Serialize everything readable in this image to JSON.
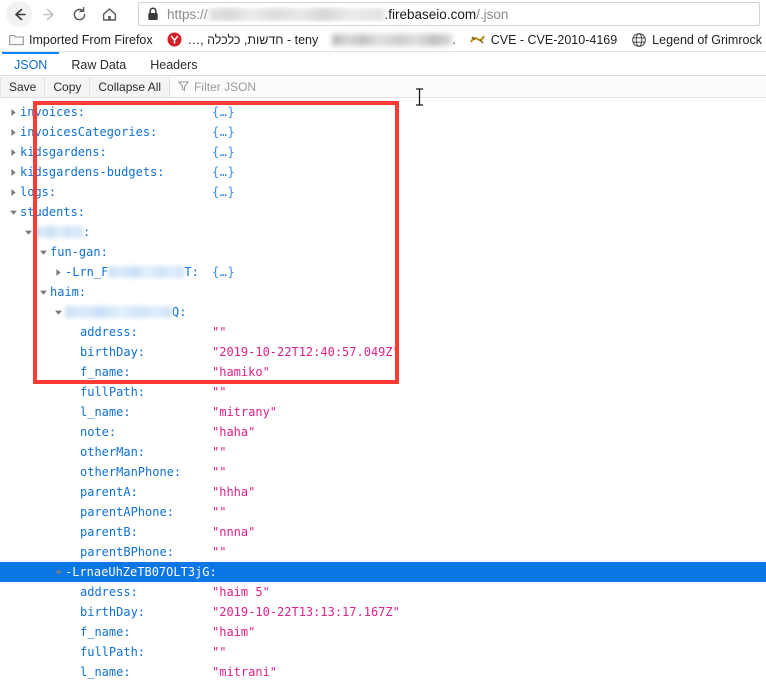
{
  "browser": {
    "nav": {
      "back_icon": "back-arrow-icon",
      "forward_icon": "forward-arrow-icon",
      "reload_icon": "reload-icon",
      "home_icon": "home-icon"
    },
    "address_bar": {
      "lock_icon": "padlock-icon",
      "scheme": "https://",
      "host_redacted": "",
      "domain": ".firebaseio.com",
      "path": "/.json"
    },
    "bookmarks": [
      {
        "icon": "folder-icon",
        "label": "Imported From Firefox",
        "redacted": false
      },
      {
        "icon": "ynet-icon",
        "label": "ynet - חדשות, כלכלה ,…",
        "redacted": false
      },
      {
        "icon": "blank-icon",
        "label": ".",
        "redacted": true
      },
      {
        "icon": "cve-icon",
        "label": "CVE - CVE-2010-4169",
        "redacted": false
      },
      {
        "icon": "globe-icon",
        "label": "Legend of Grimrock @.",
        "redacted": false
      }
    ]
  },
  "devtools": {
    "tabs": [
      {
        "label": "JSON",
        "active": true
      },
      {
        "label": "Raw Data",
        "active": false
      },
      {
        "label": "Headers",
        "active": false
      }
    ],
    "toolbar": {
      "save_label": "Save",
      "copy_label": "Copy",
      "collapse_all_label": "Collapse All",
      "filter_icon": "filter-icon",
      "filter_placeholder": "Filter JSON"
    },
    "accent_color": "#0a84ff",
    "key_color": "#0f71d3",
    "string_color": "#e0218a",
    "selection_color": "#0b76e8",
    "annotation_color": "#fb3b34"
  },
  "json_rows": [
    {
      "indent": 0,
      "twisty": "right",
      "key": "invoices",
      "value": "{…}",
      "vtype": "object"
    },
    {
      "indent": 0,
      "twisty": "right",
      "key": "invoicesCategories",
      "value": "{…}",
      "vtype": "object"
    },
    {
      "indent": 0,
      "twisty": "right",
      "key": "kidsgardens",
      "value": "{…}",
      "vtype": "object"
    },
    {
      "indent": 0,
      "twisty": "right",
      "key": "kidsgardens-budgets",
      "value": "{…}",
      "vtype": "object"
    },
    {
      "indent": 0,
      "twisty": "right",
      "key": "logs",
      "value": "{…}",
      "vtype": "object"
    },
    {
      "indent": 0,
      "twisty": "down",
      "key": "students",
      "value": "",
      "vtype": "none"
    },
    {
      "indent": 1,
      "twisty": "down",
      "key": "",
      "value": "",
      "vtype": "none",
      "redacted": true,
      "redact_width": 48
    },
    {
      "indent": 2,
      "twisty": "down",
      "key": "fun-gan",
      "value": "",
      "vtype": "none"
    },
    {
      "indent": 3,
      "twisty": "right",
      "key": "-Lrn_F",
      "key_suffix": "T",
      "value": "{…}",
      "vtype": "object",
      "redacted": true,
      "redact_width": 76
    },
    {
      "indent": 2,
      "twisty": "down",
      "key": "haim",
      "value": "",
      "vtype": "none"
    },
    {
      "indent": 3,
      "twisty": "down",
      "key": "",
      "key_suffix": "Q",
      "value": "",
      "vtype": "none",
      "redacted": true,
      "redact_width": 107
    },
    {
      "indent": 4,
      "twisty": "none",
      "key": "address",
      "value": "\"\"",
      "vtype": "string"
    },
    {
      "indent": 4,
      "twisty": "none",
      "key": "birthDay",
      "value": "\"2019-10-22T12:40:57.049Z\"",
      "vtype": "string"
    },
    {
      "indent": 4,
      "twisty": "none",
      "key": "f_name",
      "value": "\"hamiko\"",
      "vtype": "string"
    },
    {
      "indent": 4,
      "twisty": "none",
      "key": "fullPath",
      "value": "\"\"",
      "vtype": "string"
    },
    {
      "indent": 4,
      "twisty": "none",
      "key": "l_name",
      "value": "\"mitrany\"",
      "vtype": "string"
    },
    {
      "indent": 4,
      "twisty": "none",
      "key": "note",
      "value": "\"haha\"",
      "vtype": "string"
    },
    {
      "indent": 4,
      "twisty": "none",
      "key": "otherMan",
      "value": "\"\"",
      "vtype": "string"
    },
    {
      "indent": 4,
      "twisty": "none",
      "key": "otherManPhone",
      "value": "\"\"",
      "vtype": "string"
    },
    {
      "indent": 4,
      "twisty": "none",
      "key": "parentA",
      "value": "\"hhha\"",
      "vtype": "string"
    },
    {
      "indent": 4,
      "twisty": "none",
      "key": "parentAPhone",
      "value": "\"\"",
      "vtype": "string"
    },
    {
      "indent": 4,
      "twisty": "none",
      "key": "parentB",
      "value": "\"nnna\"",
      "vtype": "string"
    },
    {
      "indent": 4,
      "twisty": "none",
      "key": "parentBPhone",
      "value": "\"\"",
      "vtype": "string"
    },
    {
      "indent": 3,
      "twisty": "down",
      "key": "-LrnaeUhZeTB07OLT3jG",
      "value": "",
      "vtype": "none",
      "selected": true
    },
    {
      "indent": 4,
      "twisty": "none",
      "key": "address",
      "value": "\"haim 5\"",
      "vtype": "string"
    },
    {
      "indent": 4,
      "twisty": "none",
      "key": "birthDay",
      "value": "\"2019-10-22T13:13:17.167Z\"",
      "vtype": "string"
    },
    {
      "indent": 4,
      "twisty": "none",
      "key": "f_name",
      "value": "\"haim\"",
      "vtype": "string"
    },
    {
      "indent": 4,
      "twisty": "none",
      "key": "fullPath",
      "value": "\"\"",
      "vtype": "string"
    },
    {
      "indent": 4,
      "twisty": "none",
      "key": "l_name",
      "value": "\"mitrani\"",
      "vtype": "string"
    }
  ]
}
